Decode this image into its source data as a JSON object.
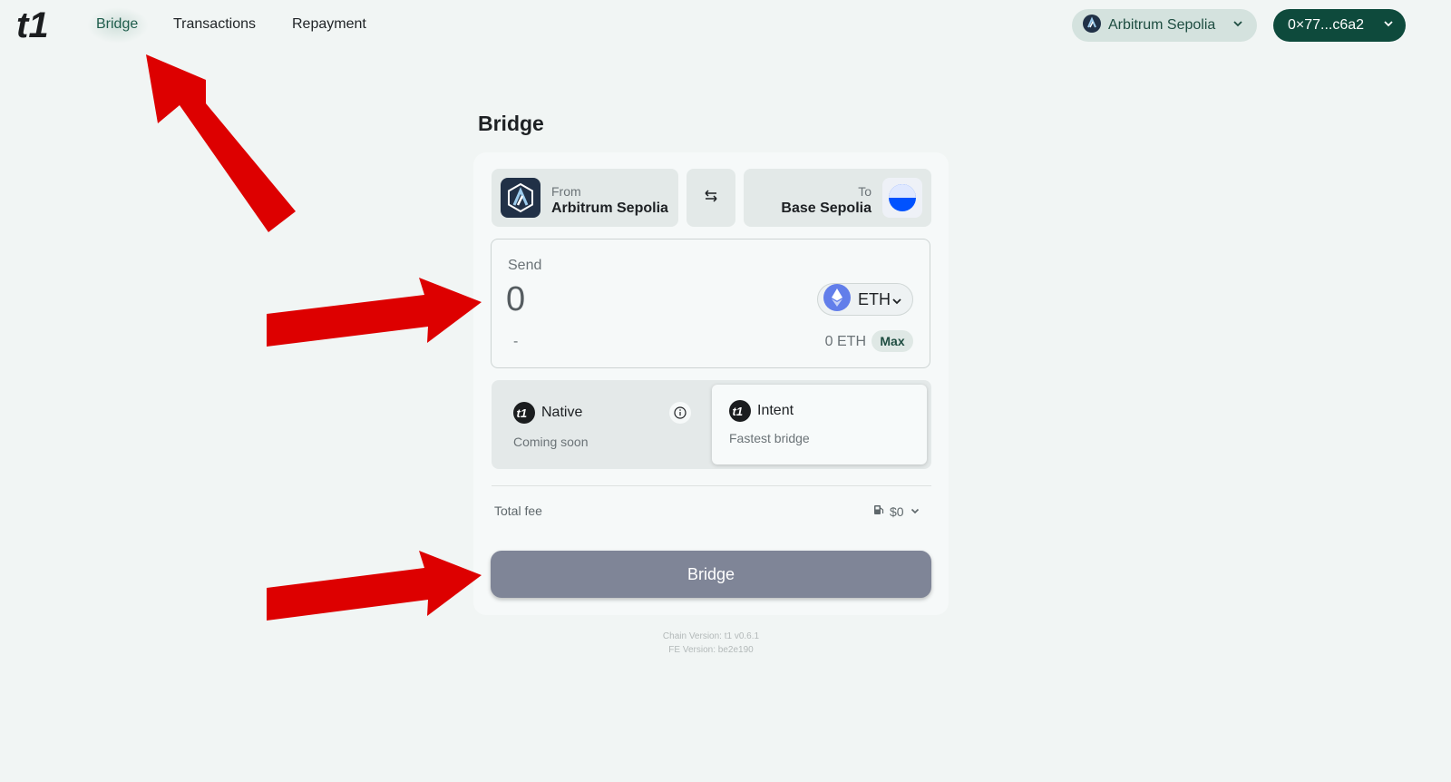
{
  "nav": {
    "links": [
      {
        "label": "Bridge",
        "active": true
      },
      {
        "label": "Transactions"
      },
      {
        "label": "Repayment"
      }
    ],
    "network_label": "Arbitrum Sepolia",
    "wallet_label": "0×77...c6a2"
  },
  "page": {
    "title": "Bridge"
  },
  "from": {
    "label": "From",
    "chain": "Arbitrum Sepolia"
  },
  "to": {
    "label": "To",
    "chain": "Base Sepolia"
  },
  "send": {
    "label": "Send",
    "amount_placeholder": "0",
    "token": "ETH",
    "usd_value": "-",
    "balance": "0 ETH",
    "max_label": "Max"
  },
  "modes": {
    "native": {
      "title": "Native",
      "subtitle": "Coming soon"
    },
    "intent": {
      "title": "Intent",
      "subtitle": "Fastest bridge",
      "selected": true
    }
  },
  "fee": {
    "label": "Total fee",
    "value": "$0"
  },
  "bridge_button": "Bridge",
  "footer": {
    "chain_version": "Chain Version: t1 v0.6.1",
    "fe_version": "FE Version: be2e190"
  },
  "colors": {
    "background": "#f1f5f4",
    "wallet_button": "#0e4a3c",
    "network_button": "#d4e2de",
    "bridge_button_disabled": "#7f8597",
    "annotation_arrow": "#dd0000"
  }
}
